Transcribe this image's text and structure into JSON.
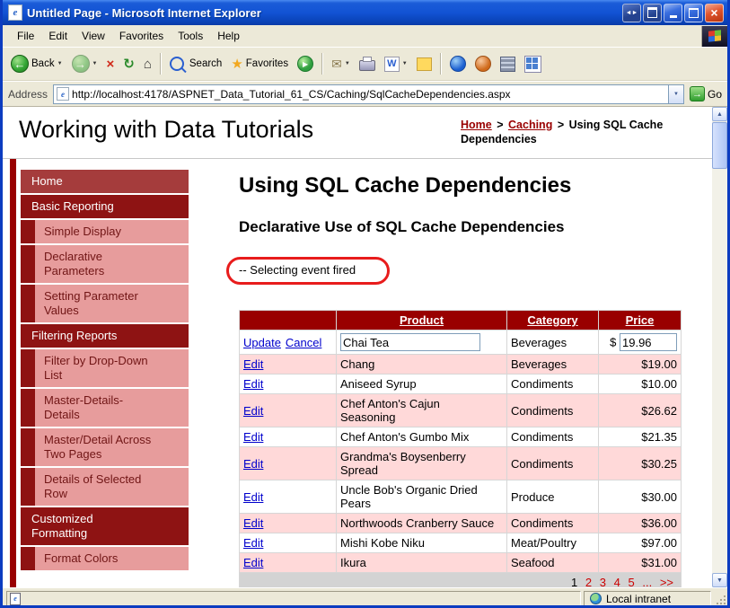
{
  "window": {
    "title": "Untitled Page - Microsoft Internet Explorer",
    "menu": {
      "items": [
        {
          "label": "File"
        },
        {
          "label": "Edit"
        },
        {
          "label": "View"
        },
        {
          "label": "Favorites"
        },
        {
          "label": "Tools"
        },
        {
          "label": "Help"
        }
      ]
    },
    "toolbar": {
      "back": "Back",
      "search": "Search",
      "favorites": "Favorites"
    },
    "address": {
      "label": "Address",
      "url": "http://localhost:4178/ASPNET_Data_Tutorial_61_CS/Caching/SqlCacheDependencies.aspx",
      "go": "Go"
    },
    "status": {
      "zone": "Local intranet"
    }
  },
  "page": {
    "site_title": "Working with Data Tutorials",
    "breadcrumb": {
      "home": "Home",
      "sep": ">",
      "section": "Caching",
      "current": "Using SQL Cache Dependencies"
    },
    "sidebar": {
      "items": [
        {
          "label": "Home"
        },
        {
          "label": "Basic Reporting"
        },
        {
          "label": "Simple Display"
        },
        {
          "label": "Declarative Parameters"
        },
        {
          "label": "Setting Parameter Values"
        },
        {
          "label": "Filtering Reports"
        },
        {
          "label": "Filter by Drop-Down List"
        },
        {
          "label": "Master-Details-Details"
        },
        {
          "label": "Master/Detail Across Two Pages"
        },
        {
          "label": "Details of Selected Row"
        },
        {
          "label": "Customized Formatting"
        },
        {
          "label": "Format Colors"
        }
      ]
    },
    "heading": "Using SQL Cache Dependencies",
    "subheading": "Declarative Use of SQL Cache Dependencies",
    "event_message": "-- Selecting event fired",
    "grid": {
      "headers": {
        "product": "Product",
        "category": "Category",
        "price": "Price"
      },
      "edit_label": "Edit",
      "edit_row": {
        "update": "Update",
        "cancel": "Cancel",
        "product_value": "Chai Tea",
        "category": "Beverages",
        "currency": "$",
        "price_value": "19.96"
      },
      "rows": [
        {
          "product": "Chang",
          "category": "Beverages",
          "price": "$19.00"
        },
        {
          "product": "Aniseed Syrup",
          "category": "Condiments",
          "price": "$10.00"
        },
        {
          "product": "Chef Anton's Cajun Seasoning",
          "category": "Condiments",
          "price": "$26.62"
        },
        {
          "product": "Chef Anton's Gumbo Mix",
          "category": "Condiments",
          "price": "$21.35"
        },
        {
          "product": "Grandma's Boysenberry Spread",
          "category": "Condiments",
          "price": "$30.25"
        },
        {
          "product": "Uncle Bob's Organic Dried Pears",
          "category": "Produce",
          "price": "$30.00"
        },
        {
          "product": "Northwoods Cranberry Sauce",
          "category": "Condiments",
          "price": "$36.00"
        },
        {
          "product": "Mishi Kobe Niku",
          "category": "Meat/Poultry",
          "price": "$97.00"
        },
        {
          "product": "Ikura",
          "category": "Seafood",
          "price": "$31.00"
        }
      ],
      "pager": {
        "current": "1",
        "links": [
          "2",
          "3",
          "4",
          "5",
          "...",
          ">>"
        ]
      }
    }
  },
  "colors": {
    "maroon": "#990000",
    "sidebar_section": "#8e1313",
    "sidebar_pink": "#e79c9c",
    "row_pink": "#ffd9d9",
    "link_blue": "#0000cc",
    "pager_red": "#cc0000",
    "annotation_red": "#e81c1c"
  }
}
